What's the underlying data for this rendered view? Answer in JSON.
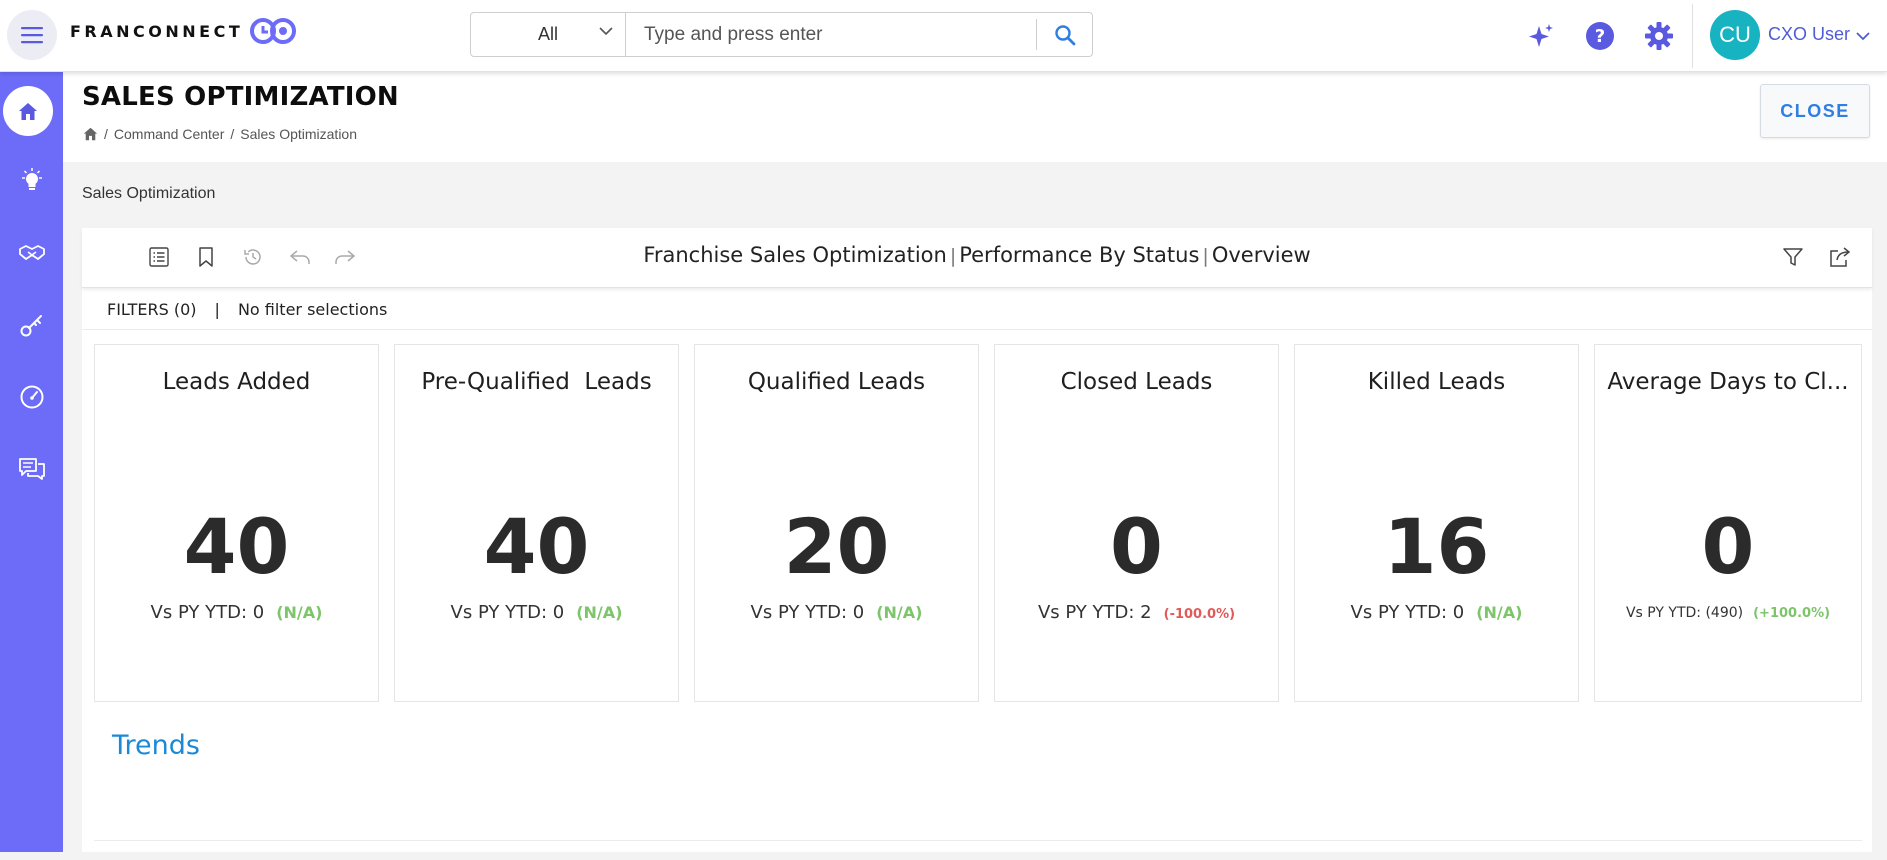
{
  "brand": {
    "name": "FRANCONNECT"
  },
  "search": {
    "scope": "All",
    "placeholder": "Type and press enter"
  },
  "user": {
    "initials": "CU",
    "name": "CXO User"
  },
  "page": {
    "title": "SALES OPTIMIZATION",
    "breadcrumb": [
      "Command Center",
      "Sales Optimization"
    ],
    "close_label": "CLOSE",
    "section_label": "Sales Optimization"
  },
  "dashboard": {
    "title_parts": [
      "Franchise Sales Optimization",
      "Performance By Status",
      "Overview"
    ],
    "filters_label": "FILTERS (0)",
    "filters_value": "No filter selections",
    "kpis": [
      {
        "title": "Leads Added",
        "value": "40",
        "compare": "Vs PY YTD: 0",
        "change": "(N/A)"
      },
      {
        "title": "Pre-Qualified  Leads",
        "value": "40",
        "compare": "Vs PY YTD: 0",
        "change": "(N/A)"
      },
      {
        "title": "Qualified Leads",
        "value": "20",
        "compare": "Vs PY YTD: 0",
        "change": "(N/A)"
      },
      {
        "title": "Closed Leads",
        "value": "0",
        "compare": "Vs PY YTD: 2",
        "change": "(-100.0%)"
      },
      {
        "title": "Killed Leads",
        "value": "16",
        "compare": "Vs PY YTD: 0",
        "change": "(N/A)"
      },
      {
        "title": "Average Days to Cl...",
        "value": "0",
        "compare": "Vs PY YTD: (490)",
        "change": "(+100.0%)"
      }
    ],
    "trends_label": "Trends"
  },
  "colors": {
    "accent": "#6c6cf8",
    "link": "#1a8ad8",
    "positive": "#7dc46b",
    "negative": "#e05a5a",
    "avatar": "#17b3c1"
  }
}
